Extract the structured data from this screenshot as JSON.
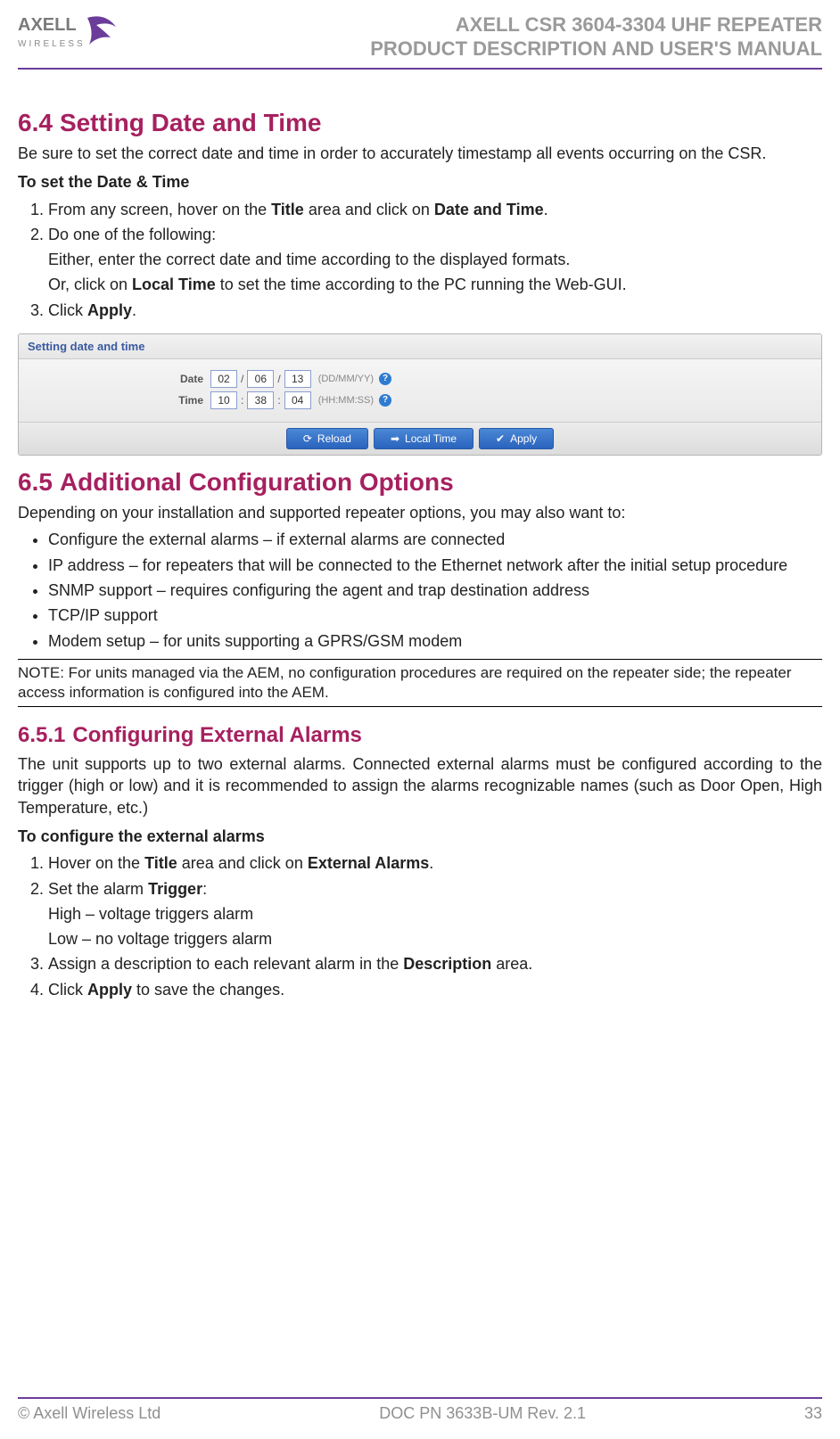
{
  "header": {
    "brand_main": "AXELL",
    "brand_sub": "WIRELESS",
    "title_line1": "AXELL CSR 3604-3304 UHF REPEATER",
    "title_line2": "PRODUCT DESCRIPTION AND USER'S MANUAL"
  },
  "section_64": {
    "num": "6.4",
    "title": "Setting Date and Time",
    "intro": "Be sure to set the correct date and time in order to accurately timestamp all events occurring on the CSR.",
    "subhead": "To set the Date & Time",
    "steps": {
      "s1_pre": "From any screen, hover on the ",
      "s1_b1": "Title",
      "s1_mid": " area and click on ",
      "s1_b2": "Date and Time",
      "s1_post": ".",
      "s2": "Do one of the following:",
      "s2_sub1": "Either, enter the correct date and time according to the displayed formats.",
      "s2_sub2_pre": "Or, click on ",
      "s2_sub2_b": "Local Time",
      "s2_sub2_post": " to set the time according to the PC running the Web-GUI.",
      "s3_pre": "Click ",
      "s3_b": "Apply",
      "s3_post": "."
    }
  },
  "ui": {
    "panel_title": "Setting date and time",
    "date_label": "Date",
    "date_dd": "02",
    "date_mm": "06",
    "date_yy": "13",
    "date_hint": "(DD/MM/YY)",
    "time_label": "Time",
    "time_hh": "10",
    "time_mi": "38",
    "time_ss": "04",
    "time_hint": "(HH:MM:SS)",
    "btn_reload": "Reload",
    "btn_local": "Local Time",
    "btn_apply": "Apply"
  },
  "section_65": {
    "num": "6.5",
    "title": "Additional Configuration Options",
    "intro": "Depending on your installation and supported repeater options, you may also want to:",
    "bullets": {
      "b1": "Configure the external alarms – if external alarms are connected",
      "b2": "IP address – for repeaters that will be connected to the Ethernet network after the initial setup procedure",
      "b3": "SNMP support – requires configuring the agent and trap destination address",
      "b4": "TCP/IP support",
      "b5": "Modem setup – for units supporting a GPRS/GSM modem"
    },
    "note": "NOTE: For units managed via the AEM, no configuration procedures are required on the repeater side; the repeater access information is configured into the AEM."
  },
  "section_651": {
    "num": "6.5.1",
    "title": "Configuring External Alarms",
    "intro": "The unit supports up to two external alarms. Connected external alarms must be configured according to the trigger (high or low) and it is recommended to assign the alarms recognizable names (such as Door Open, High Temperature, etc.)",
    "subhead": "To configure the external alarms",
    "steps": {
      "s1_pre": "Hover on the ",
      "s1_b1": "Title",
      "s1_mid": " area and click on ",
      "s1_b2": "External Alarms",
      "s1_post": ".",
      "s2_pre": "Set the alarm ",
      "s2_b": "Trigger",
      "s2_post": ":",
      "s2_sub1": "High – voltage triggers alarm",
      "s2_sub2": "Low – no voltage triggers alarm",
      "s3_pre": "Assign a description to each relevant alarm in the ",
      "s3_b": "Description",
      "s3_post": " area.",
      "s4_pre": "Click ",
      "s4_b": "Apply",
      "s4_post": " to save the changes."
    }
  },
  "footer": {
    "left": "© Axell Wireless Ltd",
    "center": "DOC PN 3633B-UM Rev. 2.1",
    "right": "33"
  }
}
